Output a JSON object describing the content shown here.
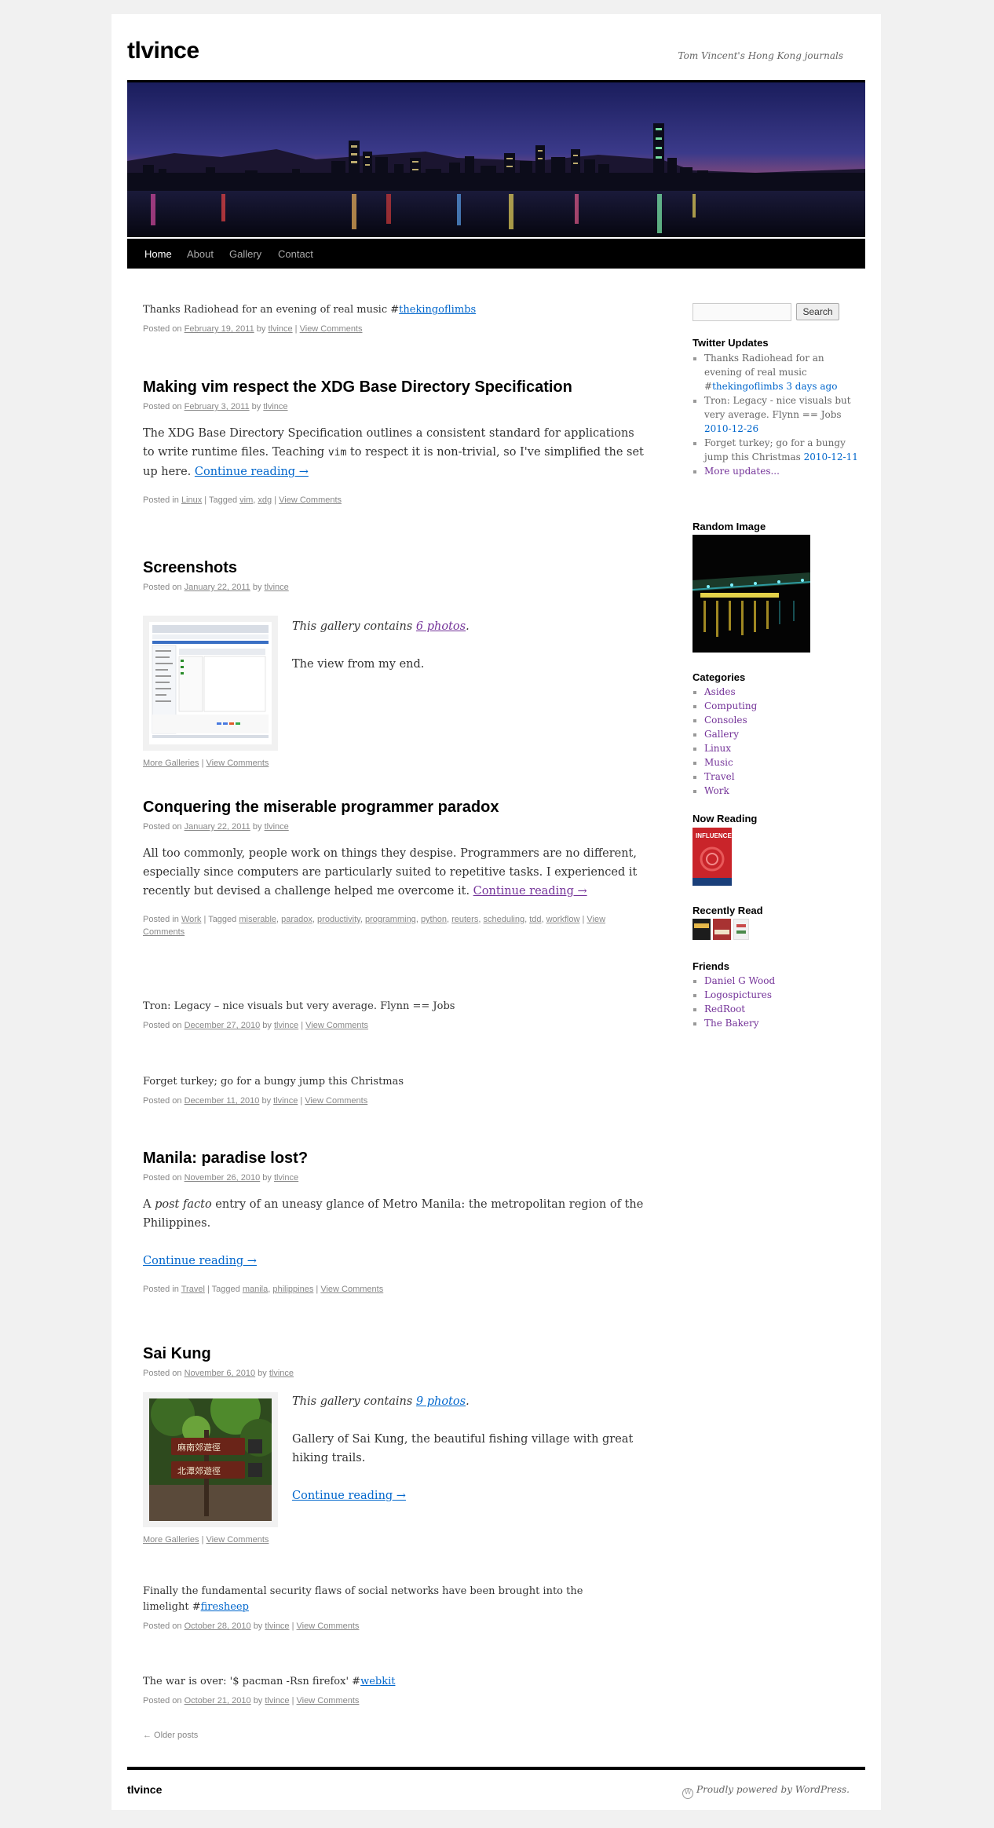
{
  "site": {
    "title": "tlvince",
    "description": "Tom Vincent's Hong Kong journals"
  },
  "nav": {
    "home": "Home",
    "about": "About",
    "gallery": "Gallery",
    "contact": "Contact"
  },
  "posts": {
    "p1": {
      "text": "Thanks Radiohead for an evening of real music #",
      "tag": "thekingoflimbs",
      "posted_on": "Posted on",
      "date": "February 19, 2011",
      "by": "by",
      "author": "tlvince",
      "comments": "View Comments"
    },
    "p2": {
      "title": "Making vim respect the XDG Base Directory Specification",
      "posted_on": "Posted on",
      "date": "February 3, 2011",
      "by": "by",
      "author": "tlvince",
      "body1": "The XDG Base Directory Specification outlines a consistent standard for applications to write runtime files. Teaching ",
      "code": "vim",
      "body2": " to respect it is non-trivial, so I've simplified the set up here. ",
      "more": "Continue reading →",
      "posted_in": "Posted in",
      "cat": "Linux",
      "tagged": "Tagged",
      "tag1": "vim",
      "tag2": "xdg",
      "comments": "View Comments"
    },
    "p3": {
      "title": "Screenshots",
      "posted_on": "Posted on",
      "date": "January 22, 2011",
      "by": "by",
      "author": "tlvince",
      "contains": "This gallery contains ",
      "count": "6 photos",
      "period": ".",
      "desc": "The view from my end.",
      "more_galleries": "More Galleries",
      "comments": "View Comments"
    },
    "p4": {
      "title": "Conquering the miserable programmer paradox",
      "posted_on": "Posted on",
      "date": "January 22, 2011",
      "by": "by",
      "author": "tlvince",
      "body": "All too commonly, people work on things they despise. Programmers are no different, especially since computers are particularly suited to repetitive tasks. I experienced it recently but devised a challenge helped me overcome it. ",
      "more": "Continue reading →",
      "posted_in": "Posted in",
      "cat": "Work",
      "tagged": "Tagged",
      "tags": [
        "miserable",
        "paradox",
        "productivity",
        "programming",
        "python",
        "reuters",
        "scheduling",
        "tdd",
        "workflow"
      ],
      "comments": "View Comments"
    },
    "p5": {
      "text": "Tron: Legacy – nice visuals but very average. Flynn == Jobs",
      "posted_on": "Posted on",
      "date": "December 27, 2010",
      "by": "by",
      "author": "tlvince",
      "comments": "View Comments"
    },
    "p6": {
      "text": "Forget turkey; go for a bungy jump this Christmas",
      "posted_on": "Posted on",
      "date": "December 11, 2010",
      "by": "by",
      "author": "tlvince",
      "comments": "View Comments"
    },
    "p7": {
      "title": "Manila: paradise lost?",
      "posted_on": "Posted on",
      "date": "November 26, 2010",
      "by": "by",
      "author": "tlvince",
      "body_a": "A ",
      "body_em": "post facto",
      "body_b": " entry of an uneasy glance of Metro Manila: the metropolitan region of the Philippines.",
      "more": "Continue reading →",
      "posted_in": "Posted in",
      "cat": "Travel",
      "tagged": "Tagged",
      "tag1": "manila",
      "tag2": "philippines",
      "comments": "View Comments"
    },
    "p8": {
      "title": "Sai Kung",
      "posted_on": "Posted on",
      "date": "November 6, 2010",
      "by": "by",
      "author": "tlvince",
      "contains": "This gallery contains ",
      "count": "9 photos",
      "period": ".",
      "desc": "Gallery of Sai Kung, the beautiful fishing village with great hiking trails.",
      "more": "Continue reading →",
      "more_galleries": "More Galleries",
      "comments": "View Comments",
      "sign1": "麻南郊遊徑",
      "sign2": "北潭郊遊徑"
    },
    "p9": {
      "text": "Finally the fundamental security flaws of social networks have been brought into the limelight #",
      "tag": "firesheep",
      "posted_on": "Posted on",
      "date": "October 28, 2010",
      "by": "by",
      "author": "tlvince",
      "comments": "View Comments"
    },
    "p10": {
      "text": "The war is over: '$ pacman -Rsn firefox' #",
      "tag": "webkit",
      "posted_on": "Posted on",
      "date": "October 21, 2010",
      "by": "by",
      "author": "tlvince",
      "comments": "View Comments"
    },
    "older": "← Older posts"
  },
  "sidebar": {
    "search_button": "Search",
    "twitter_title": "Twitter Updates",
    "tweets": [
      {
        "text": "Thanks Radiohead for an evening of real music #",
        "tag": "thekingoflimbs",
        "time": " 3 days ago"
      },
      {
        "text": "Tron: Legacy - nice visuals but very average. Flynn == Jobs ",
        "time": "2010-12-26"
      },
      {
        "text": "Forget turkey; go for a bungy jump this Christmas ",
        "time": "2010-12-11"
      }
    ],
    "more_updates": "More updates...",
    "random_image_title": "Random Image",
    "categories_title": "Categories",
    "categories": [
      "Asides",
      "Computing",
      "Consoles",
      "Gallery",
      "Linux",
      "Music",
      "Travel",
      "Work"
    ],
    "now_reading_title": "Now Reading",
    "book_title": "INFLUENCE",
    "recently_read_title": "Recently Read",
    "friends_title": "Friends",
    "friends": [
      "Daniel G Wood",
      "Logospictures",
      "RedRoot",
      "The Bakery"
    ]
  },
  "footer": {
    "site": "tlvince",
    "powered": "Proudly powered by WordPress."
  }
}
